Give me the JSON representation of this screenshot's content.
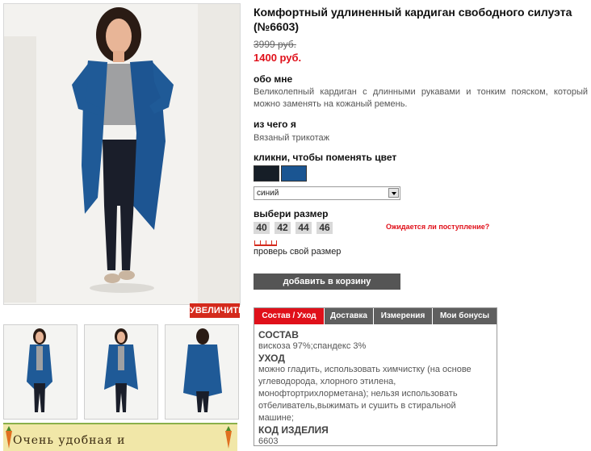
{
  "product": {
    "title": "Комфортный удлиненный кардиган свободного силуэта (№6603)",
    "old_price": "3999 руб.",
    "new_price": "1400 руб."
  },
  "zoom_label": "УВЕЛИЧИТЬ",
  "banner_text": "Очень удобная и",
  "about": {
    "heading": "обо мне",
    "text": "Великолепный кардиган с длинными рукавами и тонким пояском, который можно заменять на кожаный ремень."
  },
  "material": {
    "heading": "из чего я",
    "text": "Вязаный трикотаж"
  },
  "color": {
    "heading": "кликни, чтобы поменять цвет",
    "swatches": [
      "#161e27",
      "#1a5592"
    ],
    "selected": "синий"
  },
  "size": {
    "heading": "выбери размер",
    "options": [
      "40",
      "42",
      "44",
      "46"
    ],
    "notify_label": "Ожидается ли поступление?",
    "check_label": "проверь свой размер"
  },
  "cart_label": "добавить в корзину",
  "tabs": {
    "labels": [
      "Состав / Уход",
      "Доставка",
      "Измерения",
      "Мои бонусы"
    ],
    "content": {
      "composition_heading": "СОСТАВ",
      "composition_text": "вискоза 97%;спандекс 3%",
      "care_heading": "УХОД",
      "care_text": "можно гладить, использовать химчистку (на основе углеводорода, хлорного этилена, монофтортрихлорметана); нельзя использовать отбеливатель,выжимать и сушить в стиральной машине;",
      "code_heading": "КОД ИЗДЕЛИЯ",
      "code_text": "6603"
    }
  },
  "colors": {
    "accent": "#e0101a",
    "button": "#555555",
    "cardigan": "#1f5a97"
  }
}
